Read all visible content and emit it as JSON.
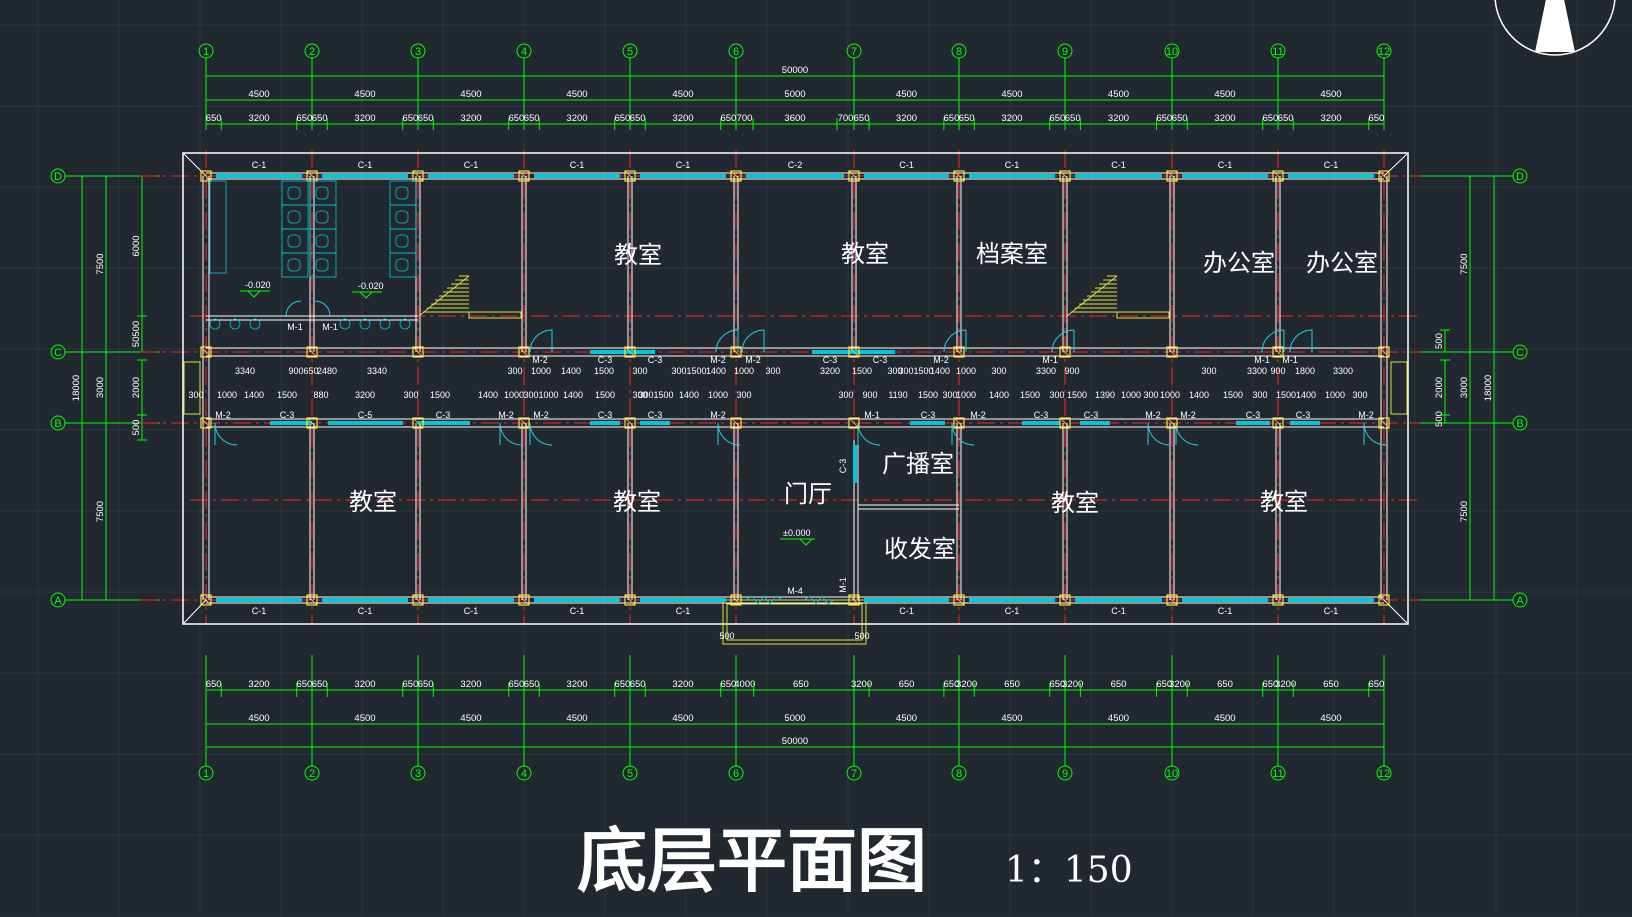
{
  "title": "底层平面图",
  "scale": "1：150",
  "colors": {
    "background": "#212830",
    "grid": "#2c343d",
    "dim": "#00ff00",
    "wall": "#ffffff",
    "axis": "#ff2020",
    "window": "#00c8d8",
    "column": "#ffe040",
    "stair": "#e0e040",
    "door": "#20d0e0"
  },
  "axes_top": {
    "labels": [
      "1",
      "2",
      "3",
      "4",
      "5",
      "6",
      "7",
      "8",
      "9",
      "10",
      "11",
      "12"
    ],
    "spans": [
      "4500",
      "4500",
      "4500",
      "4500",
      "4500",
      "5000",
      "4500",
      "4500",
      "4500",
      "4500",
      "4500"
    ],
    "total": "50000"
  },
  "axes_side": {
    "labels": [
      "D",
      "C",
      "B",
      "A"
    ]
  },
  "top_segments": [
    "650",
    "3200",
    "650",
    "650",
    "3200",
    "650",
    "650",
    "3200",
    "650",
    "650",
    "3200",
    "650",
    "650",
    "3200",
    "650",
    "700",
    "3600",
    "700",
    "650",
    "3200",
    "650",
    "650",
    "3200",
    "650",
    "650",
    "3200",
    "650",
    "650",
    "3200",
    "650",
    "650",
    "3200",
    "650",
    "650",
    "3200",
    "650"
  ],
  "bottom_segments": [
    "650",
    "3200",
    "650",
    "650",
    "3200",
    "650",
    "650",
    "3200",
    "650",
    "650",
    "3200",
    "650",
    "650",
    "3200",
    "650",
    "4000",
    "650",
    "3200",
    "650",
    "650",
    "3200",
    "650",
    "650",
    "3200",
    "650",
    "650",
    "3200",
    "650",
    "650",
    "3200",
    "650",
    "650",
    "3200",
    "650"
  ],
  "bottom_spans": [
    "4500",
    "4500",
    "4500",
    "4500",
    "4500",
    "5000",
    "4500",
    "4500",
    "4500",
    "4500",
    "4500"
  ],
  "bottom_total": "50000",
  "left_dims": {
    "outer_a": "7500",
    "outer_b": "3000",
    "outer_c": "7500",
    "total": "18000",
    "inner_a": "6000",
    "inner_b": "50500",
    "inner_c": "2000",
    "inner_d": "500"
  },
  "right_dims": {
    "outer_a": "7500",
    "outer_b": "3000",
    "outer_c": "7500",
    "total": "18000",
    "inner_a": "500",
    "inner_b": "2000",
    "inner_c": "500"
  },
  "rooms": [
    {
      "name": "教室",
      "col": "top-4"
    },
    {
      "name": "教室",
      "col": "top-6"
    },
    {
      "name": "档案室",
      "col": "top-8"
    },
    {
      "name": "办公室",
      "col": "top-10"
    },
    {
      "name": "办公室",
      "col": "top-11"
    },
    {
      "name": "教室",
      "col": "bot-1"
    },
    {
      "name": "教室",
      "col": "bot-4"
    },
    {
      "name": "门厅",
      "col": "bot-6"
    },
    {
      "name": "广播室",
      "col": "bot-7a"
    },
    {
      "name": "收发室",
      "col": "bot-7b"
    },
    {
      "name": "教室",
      "col": "bot-8"
    },
    {
      "name": "教室",
      "col": "bot-10"
    }
  ],
  "top_windows": [
    "C-1",
    "C-1",
    "C-1",
    "C-1",
    "C-1",
    "C-2",
    "C-1",
    "C-1",
    "C-1",
    "C-1",
    "C-1"
  ],
  "bottom_windows": [
    "C-1",
    "C-1",
    "C-1",
    "C-1",
    "C-1",
    "M-4",
    "C-1",
    "C-1",
    "C-1",
    "C-1",
    "C-1"
  ],
  "corridor_north_dims": [
    "3340",
    "900",
    "650",
    "2480",
    "3340",
    "300",
    "1000",
    "1400",
    "1500",
    "300",
    "3001500",
    "1400",
    "1000",
    "300",
    "3200",
    "1500",
    "300",
    "3001500",
    "1400",
    "1000",
    "300",
    "3300",
    "900",
    "300",
    "3300",
    "900",
    "1800",
    "3300"
  ],
  "corridor_south_dims": [
    "300",
    "1000",
    "1400",
    "1500",
    "880",
    "3200",
    "300",
    "1500",
    "1400",
    "1000",
    "3001000",
    "1400",
    "1500",
    "300",
    "3001500",
    "1400",
    "1000",
    "300",
    "300",
    "900",
    "1190",
    "1500",
    "300",
    "1000",
    "1400",
    "1500",
    "300",
    "1500",
    "1390",
    "1000",
    "300",
    "1000",
    "1400",
    "1500",
    "300",
    "1500",
    "1400",
    "1000",
    "300"
  ],
  "door_labels_north": [
    "M-2",
    "C-3",
    "C-3",
    "M-2",
    "M-2",
    "C-3",
    "C-3",
    "M-2",
    "M-1",
    "M-1",
    "M-1"
  ],
  "door_labels_south": [
    "M-2",
    "C-3",
    "C-5",
    "C-3",
    "M-2",
    "M-2",
    "C-3",
    "C-3",
    "M-2",
    "M-1",
    "C-3",
    "M-2",
    "C-3",
    "C-3",
    "M-2",
    "M-2",
    "C-3",
    "C-3",
    "M-2"
  ],
  "toilet_doors": [
    "M-1",
    "M-1"
  ],
  "misc_labels": {
    "elev_hall": "±0.000",
    "elev_toilet1": "-0.020",
    "elev_toilet2": "-0.020",
    "c3_vertical": "C-3",
    "m1_vertical": "M-1",
    "entrance_left": "500",
    "entrance_right": "500",
    "m4": "M-4"
  }
}
